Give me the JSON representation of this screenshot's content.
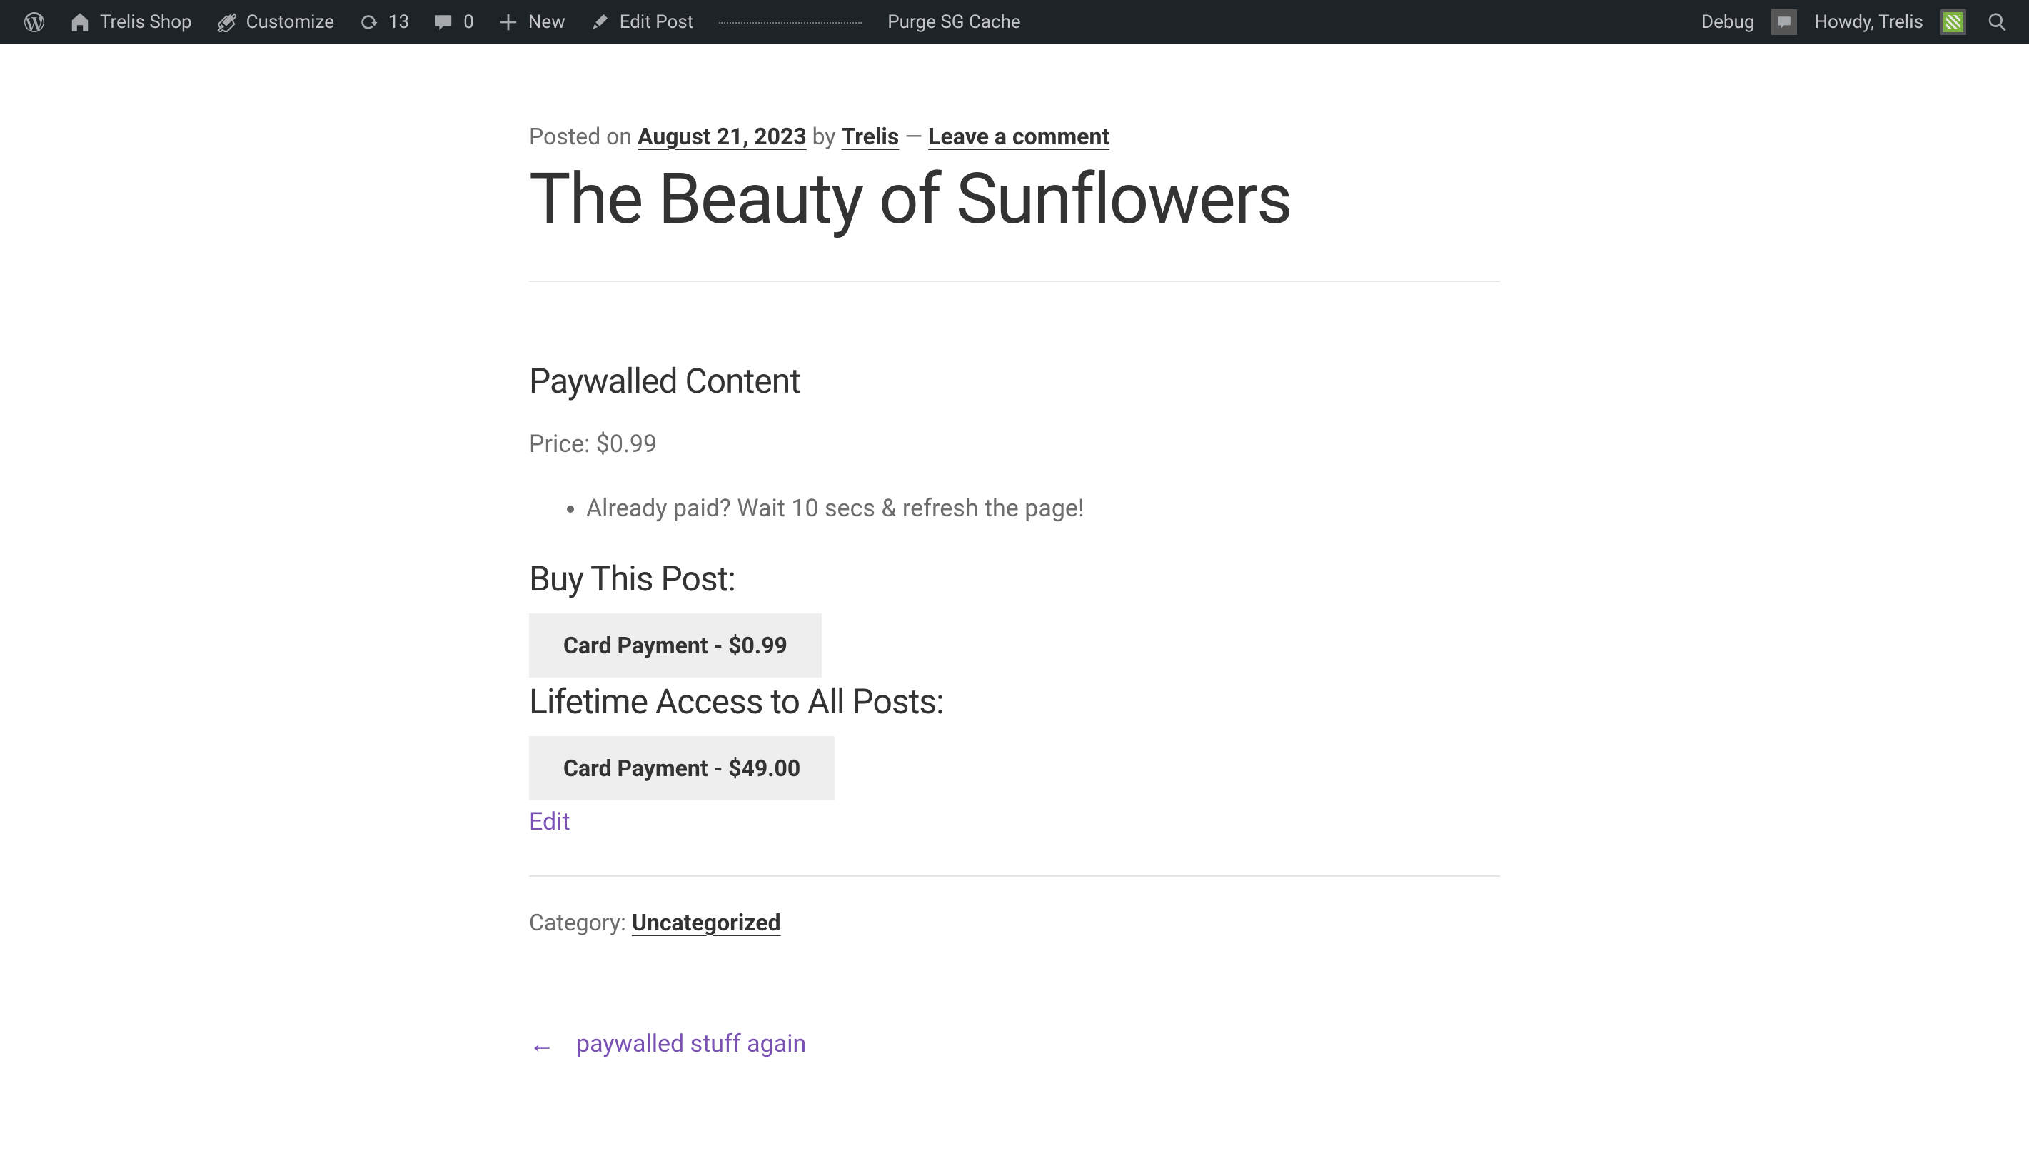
{
  "adminBar": {
    "siteName": "Trelis Shop",
    "customize": "Customize",
    "updates": "13",
    "comments": "0",
    "new": "New",
    "editPost": "Edit Post",
    "purgeCache": "Purge SG Cache",
    "debug": "Debug",
    "greeting": "Howdy, Trelis"
  },
  "post": {
    "meta": {
      "postedOn": "Posted on ",
      "date": "August 21, 2023",
      "by": " by ",
      "author": "Trelis",
      "separator": " — ",
      "leaveComment": "Leave a comment"
    },
    "title": "The Beauty of Sunflowers"
  },
  "paywall": {
    "heading": "Paywalled Content",
    "priceLabel": "Price: $0.99",
    "alreadyPaid": "Already paid? Wait 10 secs & refresh the page!",
    "buyPost": "Buy This Post:",
    "buyPostButton": "Card Payment - $0.99",
    "lifetime": "Lifetime Access to All Posts:",
    "lifetimeButton": "Card Payment - $49.00",
    "edit": "Edit"
  },
  "footer": {
    "categoryLabel": "Category: ",
    "categoryLink": "Uncategorized",
    "prevPost": "paywalled stuff again"
  }
}
